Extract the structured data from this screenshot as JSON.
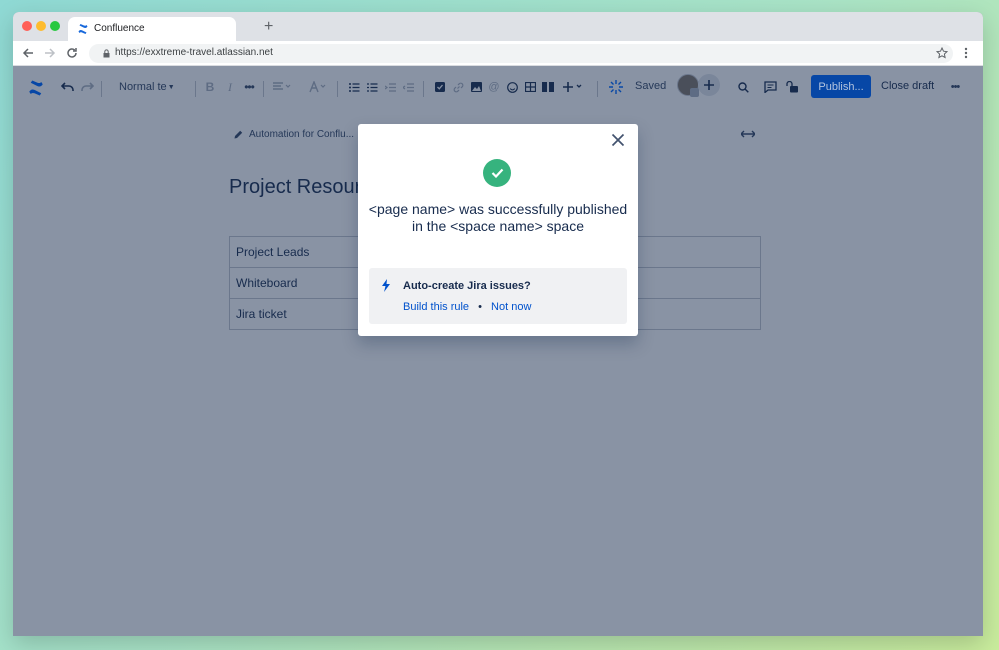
{
  "browser": {
    "tab_title": "Confluence",
    "new_tab": "+",
    "url": "https://exxtreme-travel.atlassian.net"
  },
  "toolbar": {
    "text_style": "Normal te",
    "bold": "B",
    "italic": "I",
    "saved_label": "Saved",
    "publish_label": "Publish...",
    "close_draft_label": "Close draft"
  },
  "page": {
    "breadcrumb": "Automation for Conflu...",
    "title": "Project Resourc",
    "table_rows": [
      "Project Leads",
      "Whiteboard",
      "Jira ticket"
    ]
  },
  "modal": {
    "message": "<page name> was successfully published in the <space name> space",
    "suggestion_title": "Auto-create Jira issues?",
    "build_rule_link": "Build this rule",
    "separator": "•",
    "not_now_link": "Not now"
  },
  "colors": {
    "overlay": "#8993a4",
    "primary": "#0052cc",
    "success": "#36b37e",
    "text": "#172b4d"
  }
}
